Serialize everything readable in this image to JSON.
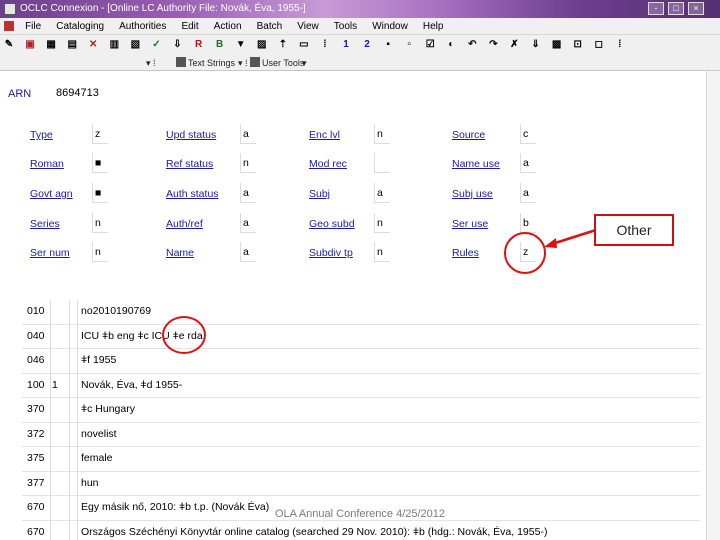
{
  "window": {
    "title": "OCLC Connexion - [Online LC Authority File: Novák, Éva, 1955-]",
    "controls": [
      "-",
      "□",
      "×"
    ]
  },
  "menu": [
    "File",
    "Cataloging",
    "Authorities",
    "Edit",
    "Action",
    "Batch",
    "View",
    "Tools",
    "Window",
    "Help"
  ],
  "toolbar1": {
    "glyphs": [
      "✎",
      "▣",
      "▦",
      "▤",
      "✕",
      "▥",
      "▧",
      "✓",
      "⇩",
      "R",
      "B",
      "▼",
      "▨",
      "⇡",
      "▭",
      "⁞",
      "1",
      "2",
      "▪",
      "▫",
      "☑",
      "◐",
      "↶",
      "↷",
      "✗",
      "⇓",
      "▩",
      "⊡",
      "◻",
      "⁞"
    ]
  },
  "toolbar2": {
    "text_strings_label": "Text Strings",
    "user_tools_label": "User Tools"
  },
  "record": {
    "arn_label": "ARN",
    "arn_value": "8694713"
  },
  "fixed_fields": {
    "col1": [
      {
        "label": "Type",
        "value": "z"
      },
      {
        "label": "Roman",
        "value": "■"
      },
      {
        "label": "Govt agn",
        "value": "■"
      },
      {
        "label": "Series",
        "value": "n"
      },
      {
        "label": "Ser num",
        "value": "n"
      }
    ],
    "col2": [
      {
        "label": "Upd status",
        "value": "a"
      },
      {
        "label": "Ref status",
        "value": "n"
      },
      {
        "label": "Auth status",
        "value": "a"
      },
      {
        "label": "Auth/ref",
        "value": "a"
      },
      {
        "label": "Name",
        "value": "a"
      }
    ],
    "col3": [
      {
        "label": "Enc lvl",
        "value": "n"
      },
      {
        "label": "Mod rec",
        "value": ""
      },
      {
        "label": "Subj",
        "value": "a"
      },
      {
        "label": "Geo subd",
        "value": "n"
      },
      {
        "label": "Subdiv tp",
        "value": "n"
      }
    ],
    "col4": [
      {
        "label": "Source",
        "value": "c"
      },
      {
        "label": "Name use",
        "value": "a"
      },
      {
        "label": "Subj use",
        "value": "a"
      },
      {
        "label": "Ser use",
        "value": "b"
      },
      {
        "label": "Rules",
        "value": "z"
      }
    ]
  },
  "variable_fields": [
    {
      "tag": "010",
      "ind1": "",
      "content": "no2010190769"
    },
    {
      "tag": "040",
      "ind1": "",
      "content": "ICU ǂb eng ǂc ICU ǂe rda"
    },
    {
      "tag": "046",
      "ind1": "",
      "content": "ǂf 1955"
    },
    {
      "tag": "100",
      "ind1": "1",
      "content": "Novák, Éva, ǂd 1955-"
    },
    {
      "tag": "370",
      "ind1": "",
      "content": "ǂc Hungary"
    },
    {
      "tag": "372",
      "ind1": "",
      "content": "novelist"
    },
    {
      "tag": "375",
      "ind1": "",
      "content": "female"
    },
    {
      "tag": "377",
      "ind1": "",
      "content": "hun"
    },
    {
      "tag": "670",
      "ind1": "",
      "content": "Egy másik nő, 2010: ǂb t.p. (Novák Éva)"
    },
    {
      "tag": "670",
      "ind1": "",
      "content": "Országos Széchényi Könyvtár online catalog (searched 29 Nov. 2010): ǂb (hdg.: Novák, Éva, 1955-)"
    }
  ],
  "annotation": {
    "callout_text": "Other",
    "color": "#e01010"
  },
  "footer": "OLA Annual Conference 4/25/2012"
}
